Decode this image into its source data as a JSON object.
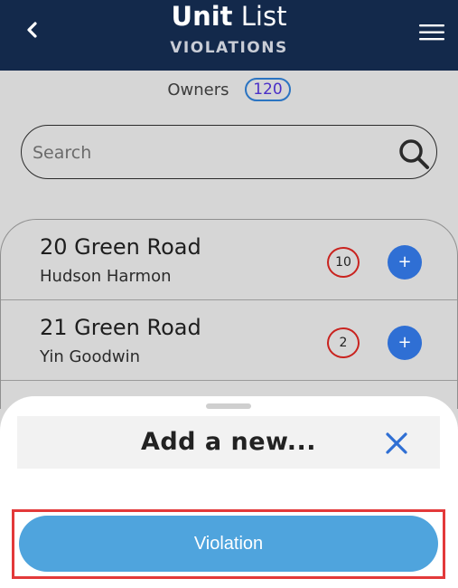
{
  "header": {
    "title_bold": "Unit",
    "title_light": "List",
    "subtitle": "VIOLATIONS"
  },
  "owners": {
    "label": "Owners",
    "count": "120"
  },
  "search": {
    "placeholder": "Search"
  },
  "units": [
    {
      "address": "20 Green Road",
      "owner": "Hudson Harmon",
      "violations": "10",
      "add_label": "+"
    },
    {
      "address": "21 Green Road",
      "owner": "Yin Goodwin",
      "violations": "2",
      "add_label": "+"
    }
  ],
  "sheet": {
    "title": "Add a new...",
    "option_label": "Violation"
  },
  "colors": {
    "header_bg": "#13294b",
    "accent_blue": "#2f6fd4",
    "button_blue": "#4fa4dd",
    "violation_red": "#c9231f",
    "highlight_red": "#e3393a"
  },
  "icons": {
    "back": "chevron-left-icon",
    "menu": "hamburger-menu-icon",
    "search": "search-icon",
    "close": "close-icon"
  }
}
